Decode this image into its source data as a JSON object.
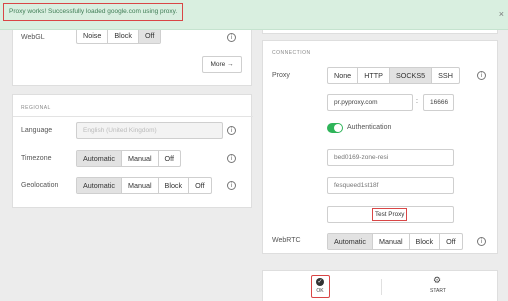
{
  "toast": {
    "message": "Proxy works! Successfully loaded google.com using proxy.",
    "close_glyph": "×"
  },
  "webgl": {
    "label": "WebGL",
    "options": [
      "Noise",
      "Block",
      "Off"
    ],
    "selected": "Off",
    "more_label": "More →"
  },
  "regional": {
    "section_title": "REGIONAL",
    "language": {
      "label": "Language",
      "placeholder": "English (United Kingdom)"
    },
    "timezone": {
      "label": "Timezone",
      "options": [
        "Automatic",
        "Manual",
        "Off"
      ],
      "selected": "Automatic"
    },
    "geolocation": {
      "label": "Geolocation",
      "options": [
        "Automatic",
        "Manual",
        "Block",
        "Off"
      ],
      "selected": "Automatic"
    }
  },
  "connection": {
    "section_title": "CONNECTION",
    "proxy": {
      "label": "Proxy",
      "options": [
        "None",
        "HTTP",
        "SOCKS5",
        "SSH"
      ],
      "selected": "SOCKS5"
    },
    "host": "pr.pyproxy.com",
    "port_separator": ":",
    "port": "16666",
    "authentication_label": "Authentication",
    "authentication_enabled": true,
    "username": "bed0169-zone-resi",
    "password": "fesqueed1st18f",
    "test_proxy_label": "Test Proxy",
    "webrtc": {
      "label": "WebRTC",
      "options": [
        "Automatic",
        "Manual",
        "Block",
        "Off"
      ],
      "selected": "Automatic"
    }
  },
  "footer": {
    "ok_label": "OK",
    "start_label": "START"
  },
  "colors": {
    "accent_green": "#2fb459",
    "highlight_red": "#d94646",
    "toast_bg": "#d9efe0"
  },
  "icons": {
    "info": "info-icon",
    "ok": "check-circle-icon",
    "start": "gear-icon",
    "close": "close-icon"
  }
}
